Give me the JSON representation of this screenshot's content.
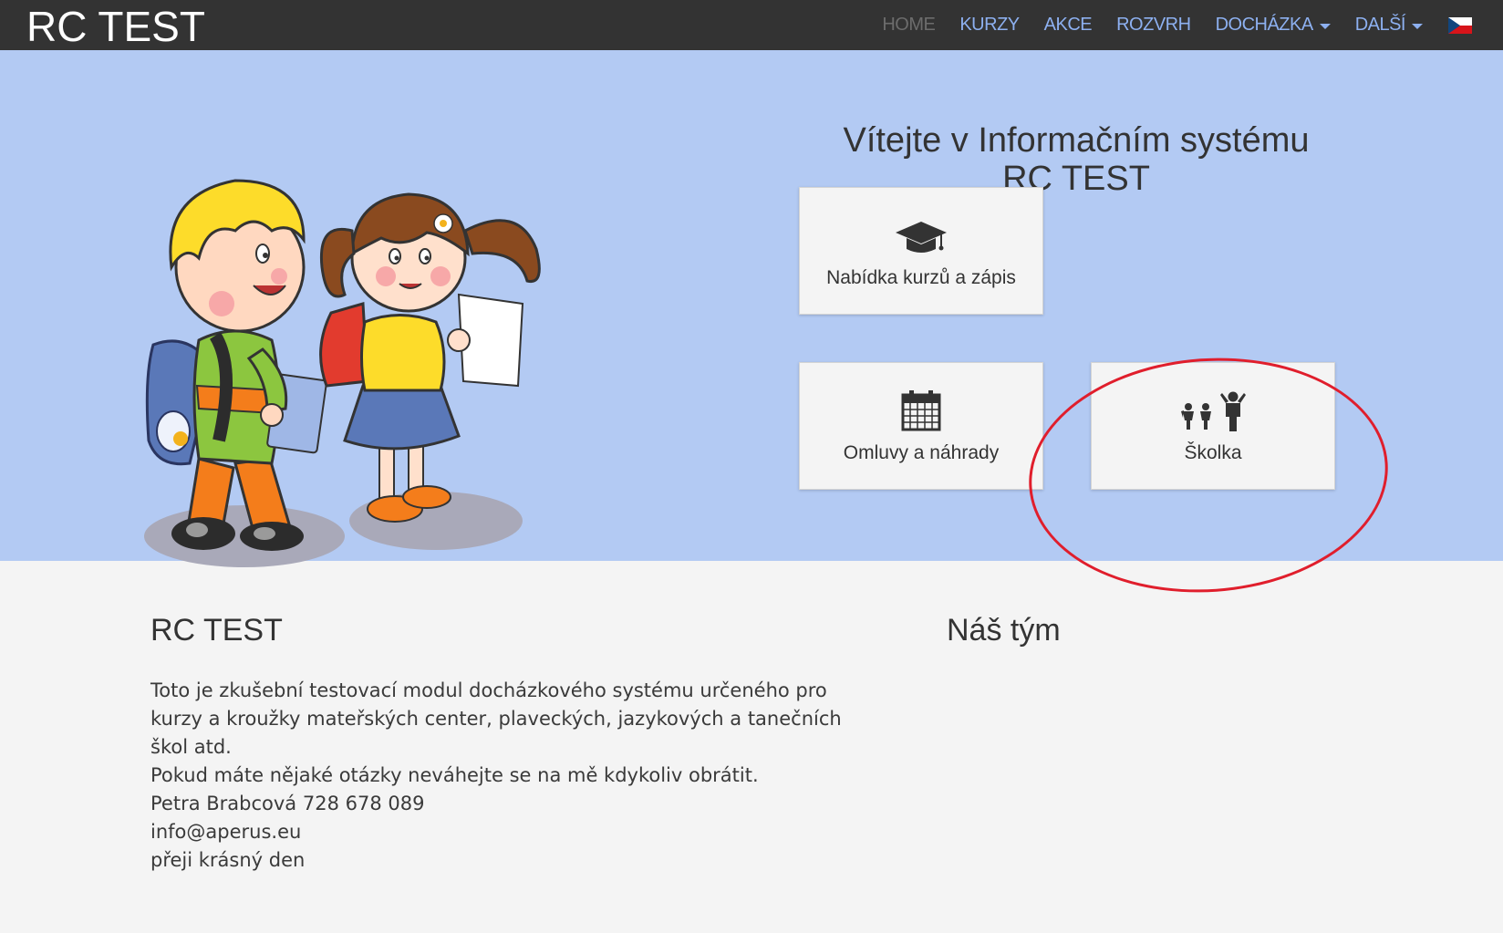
{
  "navbar": {
    "brand": "RC TEST",
    "items": [
      {
        "label": "HOME",
        "active": true
      },
      {
        "label": "KURZY"
      },
      {
        "label": "AKCE"
      },
      {
        "label": "ROZVRH"
      },
      {
        "label": "DOCHÁZKA",
        "dropdown": true
      },
      {
        "label": "DALŠÍ",
        "dropdown": true
      }
    ],
    "language_icon": "czech-flag-icon"
  },
  "hero": {
    "welcome_line1": "Vítejte v Informačním systému",
    "welcome_line2": "RC TEST",
    "illustration": "school-children-illustration",
    "tiles": [
      {
        "label": "Nabídka kurzů a zápis",
        "icon": "graduation-cap-icon"
      },
      {
        "label": "Omluvy a náhrady",
        "icon": "calendar-icon"
      },
      {
        "label": "Školka",
        "icon": "family-icon",
        "highlighted": true
      }
    ],
    "annotation_color": "#e01e2c"
  },
  "footer": {
    "title": "RC TEST",
    "lines": [
      "Toto je zkušební testovací modul docházkového systému určeného pro",
      "kurzy a kroužky mateřských center, plaveckých, jazykových a tanečních",
      "škol atd.",
      "Pokud máte nějaké otázky neváhejte se na mě kdykoliv obrátit.",
      "Petra Brabcová 728 678 089",
      "info@aperus.eu",
      "přeji krásný den"
    ],
    "team_title": "Náš tým"
  },
  "colors": {
    "navbar_bg": "#333333",
    "nav_link": "#8db0f0",
    "hero_bg": "#b3caf3",
    "page_bg": "#f4f4f4"
  }
}
